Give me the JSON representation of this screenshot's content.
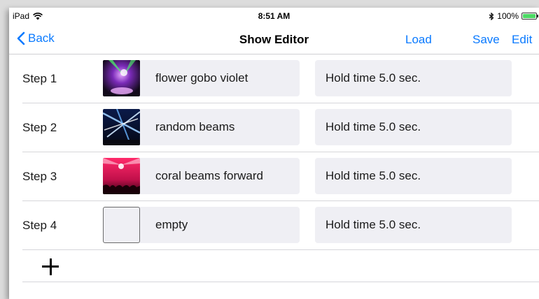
{
  "status_bar": {
    "carrier": "iPad",
    "time": "8:51 AM",
    "battery_text": "100%",
    "icons": [
      "wifi-icon",
      "bluetooth-icon",
      "battery-icon"
    ]
  },
  "nav": {
    "back_label": "Back",
    "title": "Show Editor",
    "load_label": "Load",
    "save_label": "Save",
    "edit_label": "Edit"
  },
  "colors": {
    "accent": "#0a7aff",
    "cell_bg": "#efeff4",
    "battery": "#4cd964"
  },
  "steps": [
    {
      "label": "Step 1",
      "scene": "flower gobo violet",
      "hold": "Hold time 5.0 sec.",
      "thumb": "violet-gobo"
    },
    {
      "label": "Step 2",
      "scene": "random beams",
      "hold": "Hold time 5.0 sec.",
      "thumb": "blue-beams"
    },
    {
      "label": "Step 3",
      "scene": "coral beams forward",
      "hold": "Hold time 5.0 sec.",
      "thumb": "coral-beams"
    },
    {
      "label": "Step 4",
      "scene": "empty",
      "hold": "Hold time 5.0 sec.",
      "thumb": "empty"
    }
  ],
  "add_step_icon": "plus-icon"
}
